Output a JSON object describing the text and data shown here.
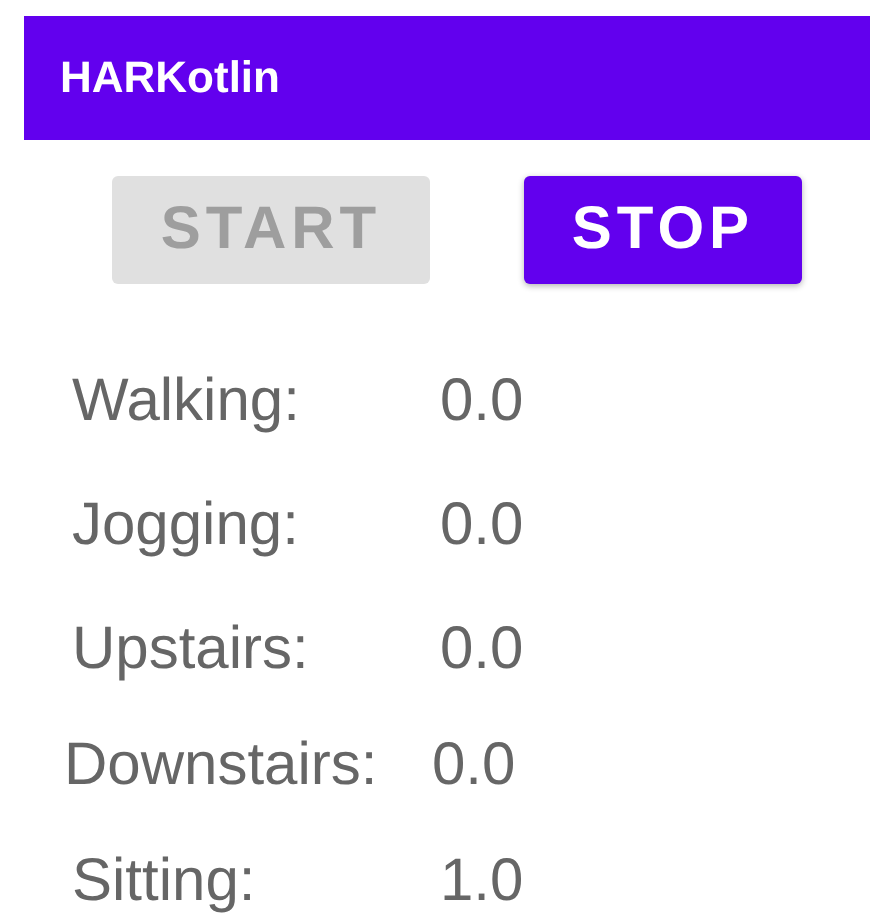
{
  "app_bar": {
    "title": "HARKotlin"
  },
  "buttons": [
    {
      "label": "START",
      "disabled": true
    },
    {
      "label": "STOP",
      "disabled": false
    }
  ],
  "activities": [
    {
      "label": "Walking:",
      "value": "0.0"
    },
    {
      "label": "Jogging:",
      "value": "0.0"
    },
    {
      "label": "Upstairs:",
      "value": "0.0"
    },
    {
      "label": "Downstairs:",
      "value": "0.0"
    },
    {
      "label": "Sitting:",
      "value": "1.0"
    }
  ]
}
